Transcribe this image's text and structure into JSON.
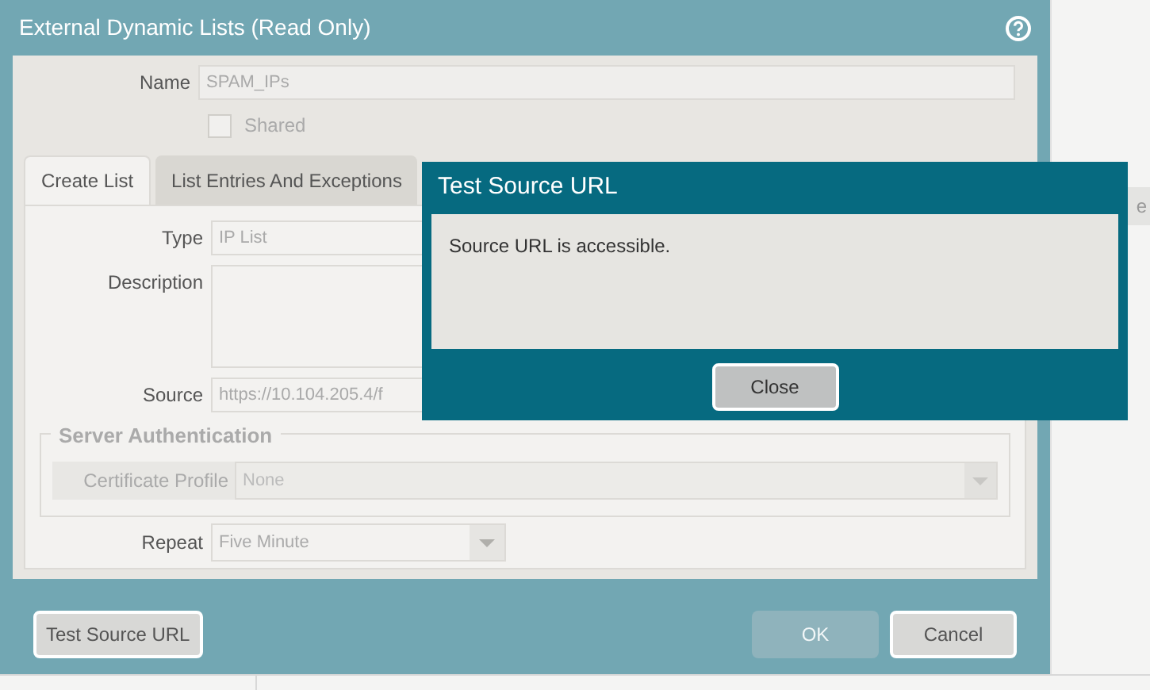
{
  "background": {
    "column_text": "e"
  },
  "dialog": {
    "title": "External Dynamic Lists (Read Only)",
    "name": {
      "label": "Name",
      "value": "SPAM_IPs"
    },
    "shared": {
      "label": "Shared",
      "checked": false
    },
    "tabs": [
      {
        "label": "Create List",
        "selected": true
      },
      {
        "label": "List Entries And Exceptions",
        "selected": false
      }
    ],
    "type": {
      "label": "Type",
      "value": "IP List"
    },
    "description": {
      "label": "Description"
    },
    "source": {
      "label": "Source",
      "value": "https://10.104.205.4/f"
    },
    "server_auth": {
      "legend": "Server Authentication",
      "certificate_profile": {
        "label": "Certificate Profile",
        "value": "None"
      }
    },
    "repeat": {
      "label": "Repeat",
      "value": "Five Minute"
    },
    "buttons": [
      {
        "label": "Test Source URL",
        "disabled": false
      },
      {
        "label": "OK",
        "disabled": true
      },
      {
        "label": "Cancel",
        "disabled": false
      }
    ]
  },
  "modal": {
    "title": "Test Source URL",
    "message": "Source URL is accessible.",
    "button": "Close"
  }
}
